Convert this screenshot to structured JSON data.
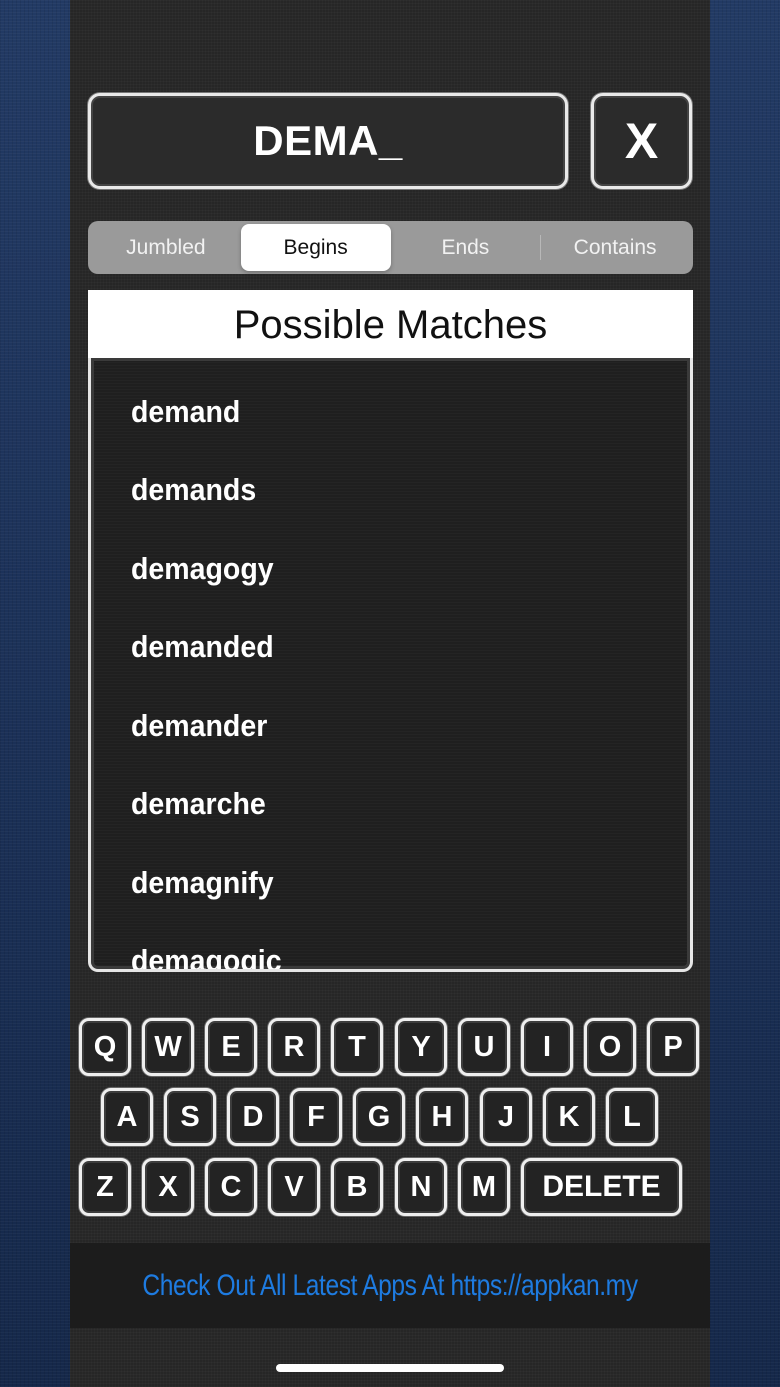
{
  "input": {
    "text": "DEMA_"
  },
  "clear_button": {
    "label": "X"
  },
  "modes": [
    {
      "label": "Jumbled",
      "active": false
    },
    {
      "label": "Begins",
      "active": true
    },
    {
      "label": "Ends",
      "active": false
    },
    {
      "label": "Contains",
      "active": false
    }
  ],
  "results": {
    "title": "Possible Matches",
    "words": [
      "demand",
      "demands",
      "demagogy",
      "demanded",
      "demander",
      "demarche",
      "demagnify",
      "demagogic"
    ]
  },
  "keyboard": {
    "row1": [
      "Q",
      "W",
      "E",
      "R",
      "T",
      "Y",
      "U",
      "I",
      "O",
      "P"
    ],
    "row2": [
      "A",
      "S",
      "D",
      "F",
      "G",
      "H",
      "J",
      "K",
      "L"
    ],
    "row3": [
      "Z",
      "X",
      "C",
      "V",
      "B",
      "N",
      "M"
    ],
    "delete_label": "DELETE"
  },
  "banner": {
    "text": "Check Out All Latest Apps At https://appkan.my"
  },
  "colors": {
    "banner_text": "#1e7be0",
    "background_blue": "#1b2c4c"
  }
}
